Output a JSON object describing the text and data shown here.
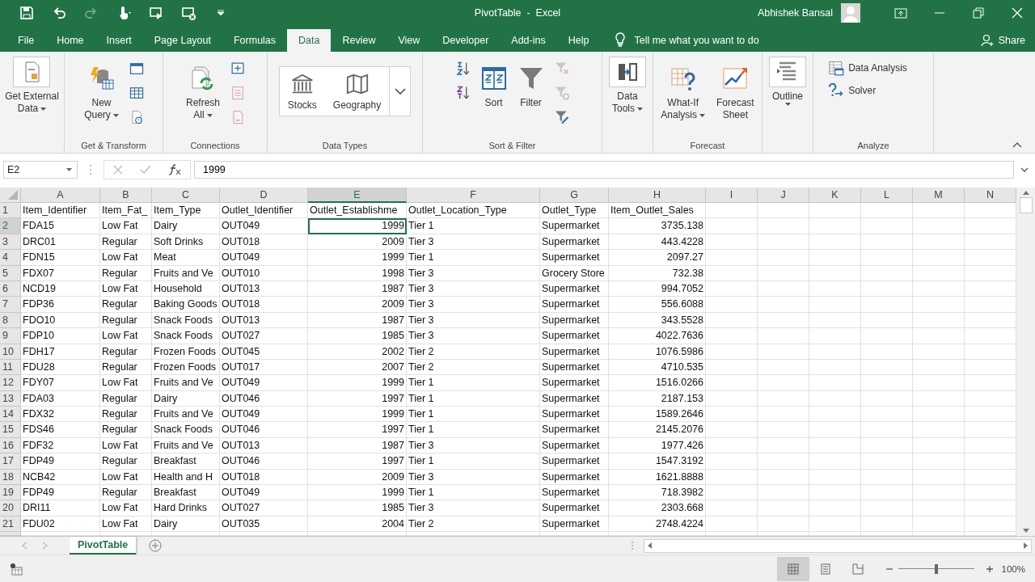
{
  "window": {
    "title": "PivotTable  -  Excel",
    "user": "Abhishek Bansal"
  },
  "quick_access": [
    {
      "disabled": false
    },
    {
      "disabled": false
    },
    {
      "disabled": true
    },
    {
      "disabled": false
    },
    {
      "disabled": false
    },
    {
      "disabled": false
    },
    {
      "disabled": false
    }
  ],
  "tabs": [
    {
      "label": "File",
      "selected": false
    },
    {
      "label": "Home",
      "selected": false
    },
    {
      "label": "Insert",
      "selected": false
    },
    {
      "label": "Page Layout",
      "selected": false
    },
    {
      "label": "Formulas",
      "selected": false
    },
    {
      "label": "Data",
      "selected": true
    },
    {
      "label": "Review",
      "selected": false
    },
    {
      "label": "View",
      "selected": false
    },
    {
      "label": "Developer",
      "selected": false
    },
    {
      "label": "Add-ins",
      "selected": false
    },
    {
      "label": "Help",
      "selected": false
    }
  ],
  "tell_me": {
    "placeholder": "Tell me what you want to do"
  },
  "share": "Share",
  "ribbon": {
    "groups": [
      {
        "items": [
          {
            "kind": "boxed",
            "lines": [
              "Get External",
              "Data"
            ],
            "dropdown": true
          }
        ]
      },
      {
        "label": "Get & Transform",
        "items": [
          {
            "kind": "large",
            "lines": [
              "New",
              "Query"
            ],
            "dropdown": true
          },
          {
            "kind": "icons",
            "icons": [
              {
                "disabled": false
              },
              {
                "disabled": false
              },
              {
                "disabled": false
              }
            ]
          }
        ]
      },
      {
        "label": "Connections",
        "items": [
          {
            "kind": "large",
            "lines": [
              "Refresh",
              "All"
            ],
            "dropdown": true
          },
          {
            "kind": "icons",
            "icons": [
              {
                "disabled": false
              },
              {
                "disabled": true
              },
              {
                "disabled": true
              }
            ]
          }
        ]
      },
      {
        "label": "Data Types",
        "items": [
          {
            "kind": "gallery",
            "options": [
              {
                "label": "Stocks"
              },
              {
                "label": "Geography"
              }
            ]
          }
        ]
      },
      {
        "label": "Sort & Filter",
        "items": [
          {
            "kind": "icons",
            "icons": [
              {
                "disabled": false
              },
              {
                "disabled": false
              }
            ]
          },
          {
            "kind": "large",
            "lines": [
              "Sort"
            ],
            "dropdown": false
          },
          {
            "kind": "large",
            "lines": [
              "Filter"
            ],
            "dropdown": false
          },
          {
            "kind": "icons",
            "icons": [
              {
                "disabled": true
              },
              {
                "disabled": true
              },
              {
                "disabled": false
              }
            ]
          }
        ]
      },
      {
        "items": [
          {
            "kind": "boxed",
            "lines": [
              "Data",
              "Tools"
            ],
            "dropdown": true
          }
        ]
      },
      {
        "label": "Forecast",
        "items": [
          {
            "kind": "large",
            "lines": [
              "What-If",
              "Analysis"
            ],
            "dropdown": true
          },
          {
            "kind": "large",
            "lines": [
              "Forecast",
              "Sheet"
            ],
            "dropdown": false
          }
        ]
      },
      {
        "items": [
          {
            "kind": "boxed",
            "lines": [
              "Outline"
            ],
            "dropdown": true
          }
        ]
      },
      {
        "label": "Analyze",
        "items": [
          {
            "kind": "list",
            "entries": [
              {
                "label": "Data Analysis"
              },
              {
                "label": "Solver"
              }
            ]
          }
        ]
      }
    ]
  },
  "formula_bar": {
    "name_box": "E2",
    "value": "1999"
  },
  "sheet": {
    "columns": [
      {
        "letter": "A",
        "kind": "text",
        "selected": false
      },
      {
        "letter": "B",
        "kind": "text",
        "selected": false
      },
      {
        "letter": "C",
        "kind": "text",
        "selected": false
      },
      {
        "letter": "D",
        "kind": "text",
        "selected": false
      },
      {
        "letter": "E",
        "kind": "number",
        "selected": true
      },
      {
        "letter": "F",
        "kind": "text",
        "selected": false
      },
      {
        "letter": "G",
        "kind": "text",
        "selected": false
      },
      {
        "letter": "H",
        "kind": "number",
        "selected": false
      },
      {
        "letter": "I",
        "selected": false
      },
      {
        "letter": "J",
        "selected": false
      },
      {
        "letter": "K",
        "selected": false
      },
      {
        "letter": "L",
        "selected": false
      },
      {
        "letter": "M",
        "selected": false
      },
      {
        "letter": "N",
        "selected": false
      }
    ],
    "rows": [
      {
        "number": "1",
        "kind": "header",
        "selected": false,
        "cells": [
          "Item_Identifier",
          "Item_Fat_",
          "Item_Type",
          "Outlet_Identifier",
          "Outlet_Establishme",
          "Outlet_Location_Type",
          "Outlet_Type",
          "Item_Outlet_Sales"
        ]
      },
      {
        "number": "2",
        "kind": "data",
        "selected": true,
        "cells": [
          "FDA15",
          "Low Fat",
          "Dairy",
          "OUT049",
          "1999",
          "Tier 1",
          "Supermarket",
          "3735.138"
        ]
      },
      {
        "number": "3",
        "kind": "data",
        "selected": false,
        "cells": [
          "DRC01",
          "Regular",
          "Soft Drinks",
          "OUT018",
          "2009",
          "Tier 3",
          "Supermarket",
          "443.4228"
        ]
      },
      {
        "number": "4",
        "kind": "data",
        "selected": false,
        "cells": [
          "FDN15",
          "Low Fat",
          "Meat",
          "OUT049",
          "1999",
          "Tier 1",
          "Supermarket",
          "2097.27"
        ]
      },
      {
        "number": "5",
        "kind": "data",
        "selected": false,
        "cells": [
          "FDX07",
          "Regular",
          "Fruits and Ve",
          "OUT010",
          "1998",
          "Tier 3",
          "Grocery Store",
          "732.38"
        ]
      },
      {
        "number": "6",
        "kind": "data",
        "selected": false,
        "cells": [
          "NCD19",
          "Low Fat",
          "Household",
          "OUT013",
          "1987",
          "Tier 3",
          "Supermarket",
          "994.7052"
        ]
      },
      {
        "number": "7",
        "kind": "data",
        "selected": false,
        "cells": [
          "FDP36",
          "Regular",
          "Baking Goods",
          "OUT018",
          "2009",
          "Tier 3",
          "Supermarket",
          "556.6088"
        ]
      },
      {
        "number": "8",
        "kind": "data",
        "selected": false,
        "cells": [
          "FDO10",
          "Regular",
          "Snack Foods",
          "OUT013",
          "1987",
          "Tier 3",
          "Supermarket",
          "343.5528"
        ]
      },
      {
        "number": "9",
        "kind": "data",
        "selected": false,
        "cells": [
          "FDP10",
          "Low Fat",
          "Snack Foods",
          "OUT027",
          "1985",
          "Tier 3",
          "Supermarket",
          "4022.7636"
        ]
      },
      {
        "number": "10",
        "kind": "data",
        "selected": false,
        "cells": [
          "FDH17",
          "Regular",
          "Frozen Foods",
          "OUT045",
          "2002",
          "Tier 2",
          "Supermarket",
          "1076.5986"
        ]
      },
      {
        "number": "11",
        "kind": "data",
        "selected": false,
        "cells": [
          "FDU28",
          "Regular",
          "Frozen Foods",
          "OUT017",
          "2007",
          "Tier 2",
          "Supermarket",
          "4710.535"
        ]
      },
      {
        "number": "12",
        "kind": "data",
        "selected": false,
        "cells": [
          "FDY07",
          "Low Fat",
          "Fruits and Ve",
          "OUT049",
          "1999",
          "Tier 1",
          "Supermarket",
          "1516.0266"
        ]
      },
      {
        "number": "13",
        "kind": "data",
        "selected": false,
        "cells": [
          "FDA03",
          "Regular",
          "Dairy",
          "OUT046",
          "1997",
          "Tier 1",
          "Supermarket",
          "2187.153"
        ]
      },
      {
        "number": "14",
        "kind": "data",
        "selected": false,
        "cells": [
          "FDX32",
          "Regular",
          "Fruits and Ve",
          "OUT049",
          "1999",
          "Tier 1",
          "Supermarket",
          "1589.2646"
        ]
      },
      {
        "number": "15",
        "kind": "data",
        "selected": false,
        "cells": [
          "FDS46",
          "Regular",
          "Snack Foods",
          "OUT046",
          "1997",
          "Tier 1",
          "Supermarket",
          "2145.2076"
        ]
      },
      {
        "number": "16",
        "kind": "data",
        "selected": false,
        "cells": [
          "FDF32",
          "Low Fat",
          "Fruits and Ve",
          "OUT013",
          "1987",
          "Tier 3",
          "Supermarket",
          "1977.426"
        ]
      },
      {
        "number": "17",
        "kind": "data",
        "selected": false,
        "cells": [
          "FDP49",
          "Regular",
          "Breakfast",
          "OUT046",
          "1997",
          "Tier 1",
          "Supermarket",
          "1547.3192"
        ]
      },
      {
        "number": "18",
        "kind": "data",
        "selected": false,
        "cells": [
          "NCB42",
          "Low Fat",
          "Health and H",
          "OUT018",
          "2009",
          "Tier 3",
          "Supermarket",
          "1621.8888"
        ]
      },
      {
        "number": "19",
        "kind": "data",
        "selected": false,
        "cells": [
          "FDP49",
          "Regular",
          "Breakfast",
          "OUT049",
          "1999",
          "Tier 1",
          "Supermarket",
          "718.3982"
        ]
      },
      {
        "number": "20",
        "kind": "data",
        "selected": false,
        "cells": [
          "DRI11",
          "Low Fat",
          "Hard Drinks",
          "OUT027",
          "1985",
          "Tier 3",
          "Supermarket",
          "2303.668"
        ]
      },
      {
        "number": "21",
        "kind": "data",
        "selected": false,
        "cells": [
          "FDU02",
          "Low Fat",
          "Dairy",
          "OUT035",
          "2004",
          "Tier 2",
          "Supermarket",
          "2748.4224"
        ]
      }
    ]
  },
  "sheet_tabs": [
    {
      "label": "PivotTable",
      "selected": true
    }
  ],
  "status_bar": {
    "views": [
      {
        "selected": true
      },
      {
        "selected": false
      },
      {
        "selected": false
      }
    ],
    "zoom": {
      "level": 0.5,
      "reading": "100%"
    }
  }
}
